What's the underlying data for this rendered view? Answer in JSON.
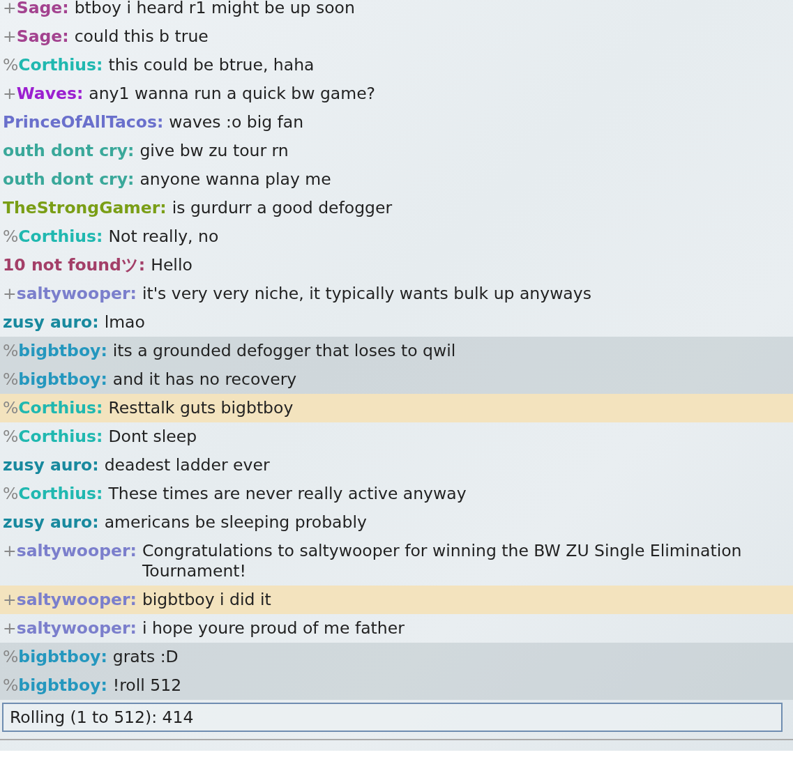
{
  "messages": [
    {
      "rank": "+",
      "user": "Sage:",
      "color": "#a3428f",
      "text": "btboy i heard r1 might be up soon",
      "kind": "plain"
    },
    {
      "rank": "+",
      "user": "Sage:",
      "color": "#a3428f",
      "text": "could this b true",
      "kind": "plain"
    },
    {
      "rank": "%",
      "user": "Corthius:",
      "color": "#20b8b0",
      "text": "this could be btrue, haha",
      "kind": "plain"
    },
    {
      "rank": "+",
      "user": "Waves:",
      "color": "#9b1fd0",
      "text": "any1 wanna run a quick bw game?",
      "kind": "plain"
    },
    {
      "user": "PrinceOfAllTacos:",
      "color": "#6a70cc",
      "text": "waves :o big fan",
      "kind": "plain"
    },
    {
      "user": "outh dont cry:",
      "color": "#3aa89a",
      "text": "give bw zu tour rn",
      "kind": "plain"
    },
    {
      "user": "outh dont cry:",
      "color": "#3aa89a",
      "text": "anyone wanna play me",
      "kind": "plain"
    },
    {
      "user": "TheStrongGamer:",
      "color": "#7a9e16",
      "text": "is gurdurr a good defogger",
      "kind": "plain"
    },
    {
      "rank": "%",
      "user": "Corthius:",
      "color": "#20b8b0",
      "text": "Not really, no",
      "kind": "plain"
    },
    {
      "user": "10 not foundツ:",
      "color": "#a33f68",
      "text": "Hello",
      "kind": "plain"
    },
    {
      "rank": "+",
      "user": "saltywooper:",
      "color": "#7b7fcc",
      "text": "it's very very niche, it typically wants bulk up anyways",
      "kind": "plain"
    },
    {
      "user": "zusy auro:",
      "color": "#18899e",
      "text": "lmao",
      "kind": "plain"
    },
    {
      "rank": "%",
      "user": "bigbtboy:",
      "color": "#2497be",
      "text": "its a grounded defogger that loses to qwil",
      "kind": "own"
    },
    {
      "rank": "%",
      "user": "bigbtboy:",
      "color": "#2497be",
      "text": "and it has no recovery",
      "kind": "own"
    },
    {
      "rank": "%",
      "user": "Corthius:",
      "color": "#20b8b0",
      "text": "Resttalk guts bigbtboy",
      "kind": "mention"
    },
    {
      "rank": "%",
      "user": "Corthius:",
      "color": "#20b8b0",
      "text": "Dont sleep",
      "kind": "plain"
    },
    {
      "user": "zusy auro:",
      "color": "#18899e",
      "text": "deadest ladder ever",
      "kind": "plain"
    },
    {
      "rank": "%",
      "user": "Corthius:",
      "color": "#20b8b0",
      "text": "These times are never really active anyway",
      "kind": "plain"
    },
    {
      "user": "zusy auro:",
      "color": "#18899e",
      "text": "americans be sleeping probably",
      "kind": "plain"
    },
    {
      "rank": "+",
      "user": "saltywooper:",
      "color": "#7b7fcc",
      "text": "Congratulations to saltywooper for winning the BW ZU Single Elimination Tournament!",
      "kind": "plain"
    },
    {
      "rank": "+",
      "user": "saltywooper:",
      "color": "#7b7fcc",
      "text": "bigbtboy i did it",
      "kind": "mention"
    },
    {
      "rank": "+",
      "user": "saltywooper:",
      "color": "#7b7fcc",
      "text": "i hope youre proud of me father",
      "kind": "plain"
    },
    {
      "rank": "%",
      "user": "bigbtboy:",
      "color": "#2497be",
      "text": "grats :D",
      "kind": "own"
    },
    {
      "rank": "%",
      "user": "bigbtboy:",
      "color": "#2497be",
      "text": "!roll 512",
      "kind": "own"
    }
  ],
  "result_box": {
    "text": "Rolling (1 to 512): 414"
  }
}
